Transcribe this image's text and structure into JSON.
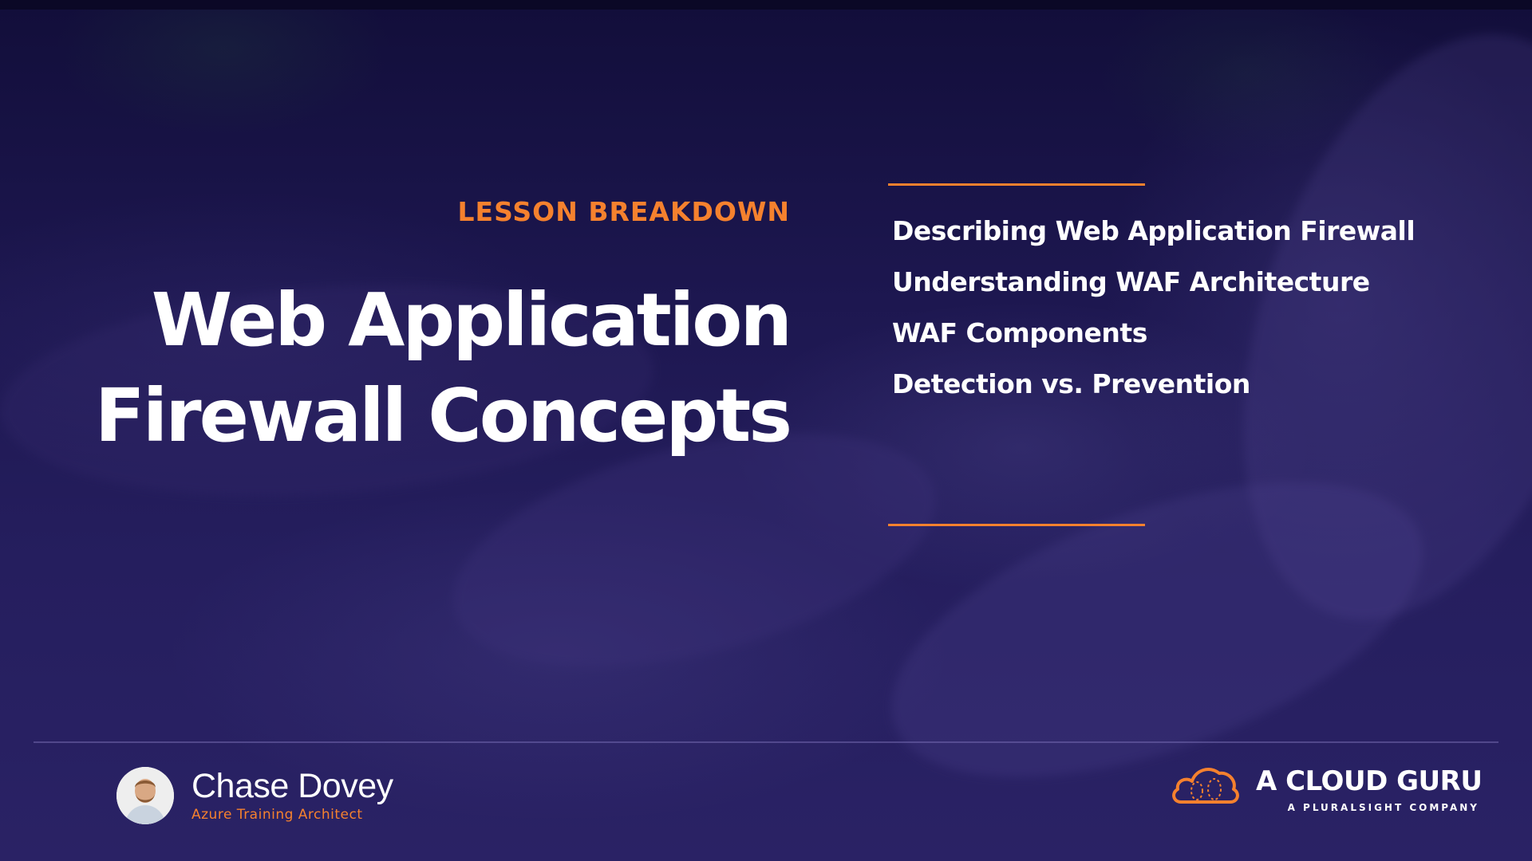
{
  "slide": {
    "section_label": "LESSON BREAKDOWN",
    "title_lines": [
      "Web Application",
      "Firewall Concepts"
    ],
    "topics": [
      "Describing Web Application Firewall",
      "Understanding WAF Architecture",
      "WAF Components",
      "Detection vs. Prevention"
    ]
  },
  "presenter": {
    "name": "Chase Dovey",
    "role": "Azure Training Architect"
  },
  "brand": {
    "name": "A CLOUD GURU",
    "tagline": "A PLURALSIGHT COMPANY",
    "logo_icon": "cloud-logo-icon"
  },
  "colors": {
    "accent": "#f5812e",
    "background": "#1d1750",
    "text": "#ffffff"
  }
}
